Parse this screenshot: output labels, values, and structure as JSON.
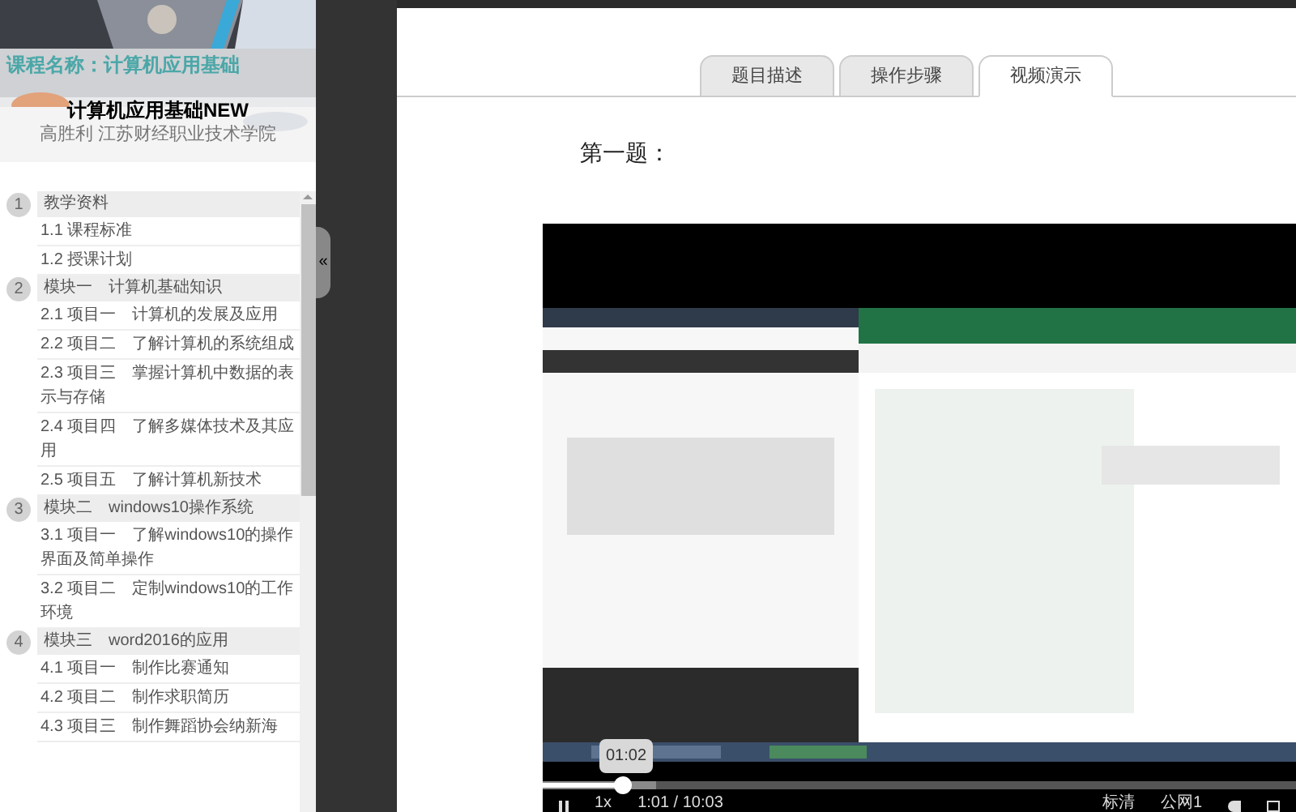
{
  "course": {
    "label": "课程名称：计算机应用基础",
    "title": "计算机应用基础NEW",
    "author": "高胜利 江苏财经职业技术学院"
  },
  "collapse_button": "«",
  "sections": [
    {
      "number": "1",
      "title": "教学资料",
      "children": [
        {
          "title": "1.1  课程标准"
        },
        {
          "title": "1.2  授课计划"
        }
      ]
    },
    {
      "number": "2",
      "title": "模块一　计算机基础知识",
      "children": [
        {
          "title": "2.1  项目一　计算机的发展及应用"
        },
        {
          "title": "2.2  项目二　了解计算机的系统组成"
        },
        {
          "title": "2.3  项目三　掌握计算机中数据的表示与存储"
        },
        {
          "title": "2.4  项目四　了解多媒体技术及其应用"
        },
        {
          "title": "2.5  项目五　了解计算机新技术"
        }
      ]
    },
    {
      "number": "3",
      "title": "模块二　windows10操作系统",
      "children": [
        {
          "title": "3.1  项目一　了解windows10的操作界面及简单操作"
        },
        {
          "title": "3.2  项目二　定制windows10的工作环境"
        }
      ]
    },
    {
      "number": "4",
      "title": "模块三　word2016的应用",
      "children": [
        {
          "title": "4.1  项目一　制作比赛通知"
        },
        {
          "title": "4.2  项目二　制作求职简历"
        },
        {
          "title": "4.3  项目三　制作舞蹈协会纳新海"
        }
      ]
    }
  ],
  "tabs": [
    {
      "label": "题目描述",
      "selected": false
    },
    {
      "label": "操作步骤",
      "selected": false
    },
    {
      "label": "视频演示",
      "selected": true
    }
  ],
  "question_title": "第一题：",
  "video": {
    "kind": "picture",
    "tooltip": "01:02",
    "level": 0.105,
    "speed": "1x",
    "time": "1:01 / 10:03",
    "quality": "标清",
    "line": "公网1"
  }
}
